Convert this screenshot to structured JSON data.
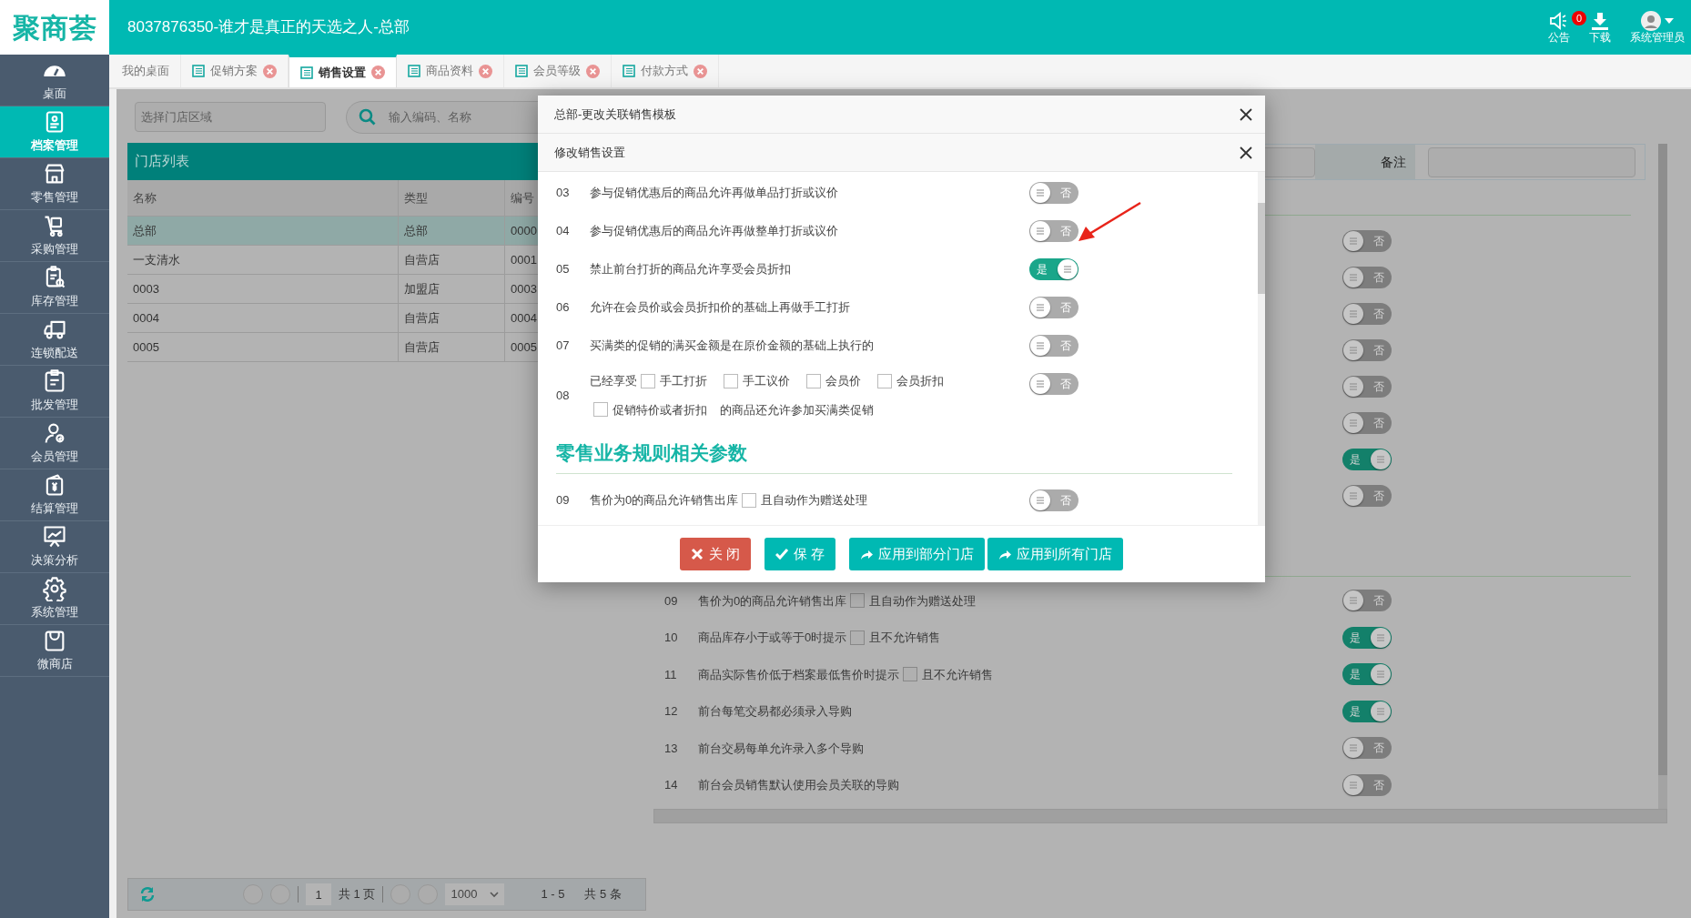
{
  "header": {
    "logo": "聚商荟",
    "title": "8037876350-谁才是真正的天选之人-总部",
    "notice": {
      "label": "公告",
      "badge": "0"
    },
    "download": {
      "label": "下载"
    },
    "user": {
      "label": "系统管理员"
    }
  },
  "sidebar": {
    "items": [
      {
        "label": "桌面",
        "selected": false
      },
      {
        "label": "档案管理",
        "selected": true
      },
      {
        "label": "零售管理",
        "selected": false
      },
      {
        "label": "采购管理",
        "selected": false
      },
      {
        "label": "库存管理",
        "selected": false
      },
      {
        "label": "连锁配送",
        "selected": false
      },
      {
        "label": "批发管理",
        "selected": false
      },
      {
        "label": "会员管理",
        "selected": false
      },
      {
        "label": "结算管理",
        "selected": false
      },
      {
        "label": "决策分析",
        "selected": false
      },
      {
        "label": "系统管理",
        "selected": false
      },
      {
        "label": "微商店",
        "selected": false
      }
    ]
  },
  "tabs": [
    {
      "label": "我的桌面",
      "closable": false,
      "selected": false
    },
    {
      "label": "促销方案",
      "closable": true,
      "selected": false
    },
    {
      "label": "销售设置",
      "closable": true,
      "selected": true
    },
    {
      "label": "商品资料",
      "closable": true,
      "selected": false
    },
    {
      "label": "会员等级",
      "closable": true,
      "selected": false
    },
    {
      "label": "付款方式",
      "closable": true,
      "selected": false
    }
  ],
  "store_panel": {
    "region_placeholder": "选择门店区域",
    "search_placeholder": "输入编码、名称",
    "title": "门店列表",
    "columns": [
      "名称",
      "类型",
      "编号"
    ],
    "rows": [
      {
        "cells": [
          "总部",
          "总部",
          "0000"
        ],
        "selected": true
      },
      {
        "cells": [
          "一支清水",
          "自营店",
          "0001"
        ],
        "selected": false
      },
      {
        "cells": [
          "0003",
          "加盟店",
          "0003"
        ],
        "selected": false
      },
      {
        "cells": [
          "0004",
          "自营店",
          "0004"
        ],
        "selected": false
      },
      {
        "cells": [
          "0005",
          "自营店",
          "0005"
        ],
        "selected": false
      }
    ]
  },
  "pager": {
    "page": "1",
    "pages": "共 1 页",
    "page_size": "1000",
    "range": "1 - 5",
    "total": "共 5 条"
  },
  "settings_panel": {
    "remark_label": "备注",
    "switches": [
      {
        "label": "否",
        "on": false
      },
      {
        "label": "否",
        "on": false
      },
      {
        "label": "否",
        "on": false
      },
      {
        "label": "否",
        "on": false
      },
      {
        "label": "否",
        "on": false
      },
      {
        "label": "否",
        "on": false
      },
      {
        "label": "是",
        "on": true
      },
      {
        "label": "否",
        "on": false
      }
    ],
    "rows": [
      {
        "no": "09",
        "segments": [
          {
            "kind": "text",
            "text": "售价为0的商品允许销售出库"
          },
          {
            "kind": "checkbox",
            "label": "且自动作为赠送处理",
            "checked": false
          }
        ],
        "switch": {
          "label": "否",
          "on": false
        }
      },
      {
        "no": "10",
        "segments": [
          {
            "kind": "text",
            "text": "商品库存小于或等于0时提示"
          },
          {
            "kind": "checkbox",
            "label": "且不允许销售",
            "checked": false
          }
        ],
        "switch": {
          "label": "是",
          "on": true
        }
      },
      {
        "no": "11",
        "segments": [
          {
            "kind": "text",
            "text": "商品实际售价低于档案最低售价时提示"
          },
          {
            "kind": "checkbox",
            "label": "且不允许销售",
            "checked": false
          }
        ],
        "switch": {
          "label": "是",
          "on": true
        }
      },
      {
        "no": "12",
        "segments": [
          {
            "kind": "text",
            "text": "前台每笔交易都必须录入导购"
          }
        ],
        "switch": {
          "label": "是",
          "on": true
        }
      },
      {
        "no": "13",
        "segments": [
          {
            "kind": "text",
            "text": "前台交易每单允许录入多个导购"
          }
        ],
        "switch": {
          "label": "否",
          "on": false
        }
      },
      {
        "no": "14",
        "segments": [
          {
            "kind": "text",
            "text": "前台会员销售默认使用会员关联的导购"
          }
        ],
        "switch": {
          "label": "否",
          "on": false
        }
      }
    ]
  },
  "dialog": {
    "title": "总部-更改关联销售模板",
    "subtitle": "修改销售设置",
    "items": [
      {
        "kind": "setting",
        "no": "03",
        "segments": [
          {
            "kind": "text",
            "text": "参与促销优惠后的商品允许再做单品打折或议价"
          }
        ],
        "switch": {
          "label": "否",
          "on": false
        }
      },
      {
        "kind": "setting",
        "no": "04",
        "segments": [
          {
            "kind": "text",
            "text": "参与促销优惠后的商品允许再做整单打折或议价"
          }
        ],
        "switch": {
          "label": "否",
          "on": false
        }
      },
      {
        "kind": "setting",
        "no": "05",
        "segments": [
          {
            "kind": "text",
            "text": "禁止前台打折的商品允许享受会员折扣"
          }
        ],
        "switch": {
          "label": "是",
          "on": true
        }
      },
      {
        "kind": "setting",
        "no": "06",
        "segments": [
          {
            "kind": "text",
            "text": "允许在会员价或会员折扣价的基础上再做手工打折"
          }
        ],
        "switch": {
          "label": "否",
          "on": false
        }
      },
      {
        "kind": "setting",
        "no": "07",
        "segments": [
          {
            "kind": "text",
            "text": "买满类的促销的满买金额是在原价金额的基础上执行的"
          }
        ],
        "switch": {
          "label": "否",
          "on": false
        }
      },
      {
        "kind": "setting",
        "no": "08",
        "segments": [
          {
            "kind": "text",
            "text": "已经享受"
          },
          {
            "kind": "checkbox",
            "label": "手工打折",
            "checked": false
          },
          {
            "kind": "checkbox",
            "label": "手工议价",
            "checked": false
          },
          {
            "kind": "checkbox",
            "label": "会员价",
            "checked": false
          },
          {
            "kind": "checkbox",
            "label": "会员折扣",
            "checked": false
          },
          {
            "kind": "break"
          },
          {
            "kind": "checkbox",
            "label": "促销特价或者折扣",
            "checked": false
          },
          {
            "kind": "text",
            "text": "的商品还允许参加买满类促销"
          }
        ],
        "switch": {
          "label": "否",
          "on": false
        }
      },
      {
        "kind": "heading",
        "text": "零售业务规则相关参数"
      },
      {
        "kind": "setting",
        "no": "09",
        "segments": [
          {
            "kind": "text",
            "text": "售价为0的商品允许销售出库"
          },
          {
            "kind": "checkbox",
            "label": "且自动作为赠送处理",
            "checked": false
          }
        ],
        "switch": {
          "label": "否",
          "on": false
        }
      }
    ],
    "buttons": [
      {
        "label": "关 闭",
        "kind": "close"
      },
      {
        "label": "保 存",
        "kind": "save"
      },
      {
        "label": "应用到部分门店",
        "kind": "apply"
      },
      {
        "label": "应用到所有门店",
        "kind": "apply"
      }
    ]
  }
}
